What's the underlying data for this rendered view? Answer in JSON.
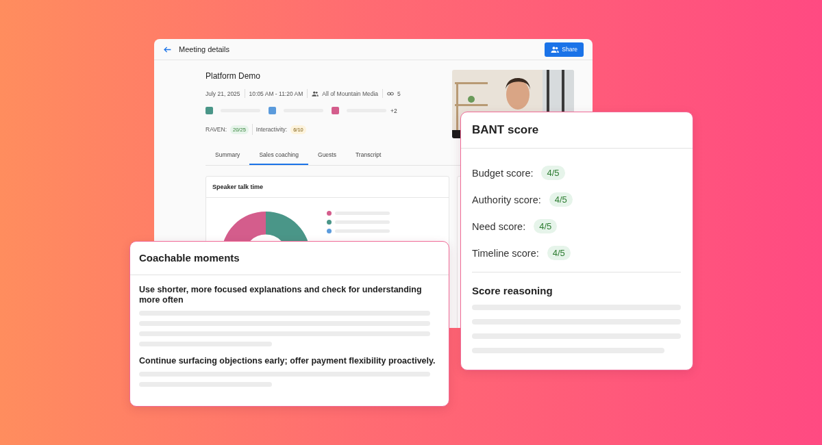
{
  "window": {
    "title": "Meeting details",
    "share_button": "Share"
  },
  "meeting": {
    "title": "Platform Demo",
    "date": "July 21, 2025",
    "time": "10:05 AM - 11:20 AM",
    "account": "All of Mountain Media",
    "links": "5",
    "participants": [
      {
        "color": "#4a9688"
      },
      {
        "color": "#5b9bdc"
      },
      {
        "color": "#d45d8c"
      }
    ],
    "more_participants": "+2",
    "scores": [
      {
        "label": "RAVEN:",
        "value": "20/25",
        "color": "#e6f4ea"
      },
      {
        "label": "Interactivity:",
        "value": "6/10",
        "color": "#fdf3dc"
      }
    ]
  },
  "tabs": [
    {
      "label": "Summary",
      "selected": false
    },
    {
      "label": "Sales coaching",
      "selected": true
    },
    {
      "label": "Guests",
      "selected": false
    },
    {
      "label": "Transcript",
      "selected": false
    }
  ],
  "talk_time": {
    "title": "Speaker talk time",
    "legend": [
      {
        "color": "#d45d8c"
      },
      {
        "color": "#4a9688"
      },
      {
        "color": "#5b9bdc"
      }
    ]
  },
  "bant": {
    "title": "BANT score",
    "scores": [
      {
        "label": "Budget score:",
        "value": "4/5"
      },
      {
        "label": "Authority score:",
        "value": "4/5"
      },
      {
        "label": "Need score:",
        "value": "4/5"
      },
      {
        "label": "Timeline score:",
        "value": "4/5"
      }
    ],
    "reasoning_title": "Score reasoning"
  },
  "coaching": {
    "title": "Coachable moments",
    "moments": [
      {
        "text": "Use shorter, more focused explanations and check for understanding more often"
      },
      {
        "text": "Continue surfacing objections early; offer payment flexibility proactively."
      }
    ]
  }
}
